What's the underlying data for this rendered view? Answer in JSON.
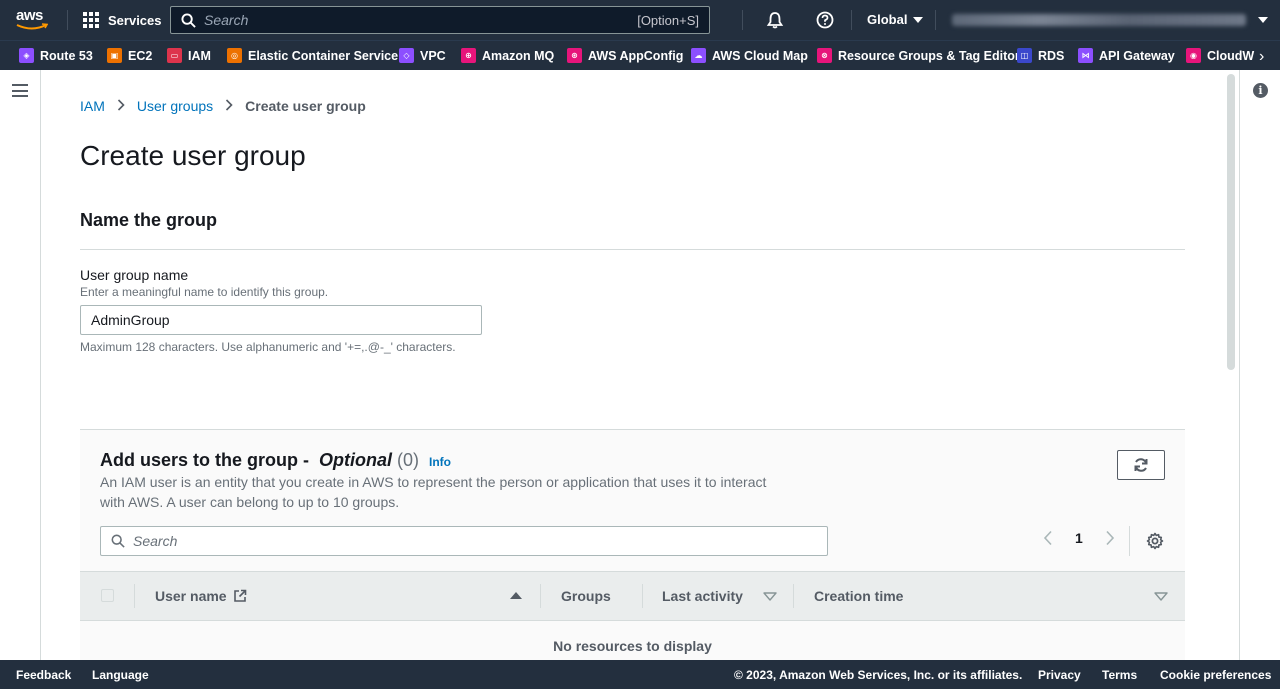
{
  "topnav": {
    "logo_text": "aws",
    "services_label": "Services",
    "search_placeholder": "Search",
    "search_shortcut": "[Option+S]",
    "region_label": "Global"
  },
  "favorites": [
    {
      "label": "Route 53",
      "color": "#8c4fff"
    },
    {
      "label": "EC2",
      "color": "#ed7100"
    },
    {
      "label": "IAM",
      "color": "#dd344c"
    },
    {
      "label": "Elastic Container Service",
      "color": "#ed7100"
    },
    {
      "label": "VPC",
      "color": "#8c4fff"
    },
    {
      "label": "Amazon MQ",
      "color": "#e7157b"
    },
    {
      "label": "AWS AppConfig",
      "color": "#e7157b"
    },
    {
      "label": "AWS Cloud Map",
      "color": "#8c4fff"
    },
    {
      "label": "Resource Groups & Tag Editor",
      "color": "#e7157b"
    },
    {
      "label": "RDS",
      "color": "#3b48cc"
    },
    {
      "label": "API Gateway",
      "color": "#8c4fff"
    },
    {
      "label": "CloudW",
      "color": "#e7157b"
    }
  ],
  "breadcrumb": {
    "items": [
      "IAM",
      "User groups",
      "Create user group"
    ]
  },
  "page_title": "Create user group",
  "name_section": {
    "title": "Name the group",
    "field_label": "User group name",
    "field_description": "Enter a meaningful name to identify this group.",
    "field_value": "AdminGroup",
    "field_constraint": "Maximum 128 characters. Use alphanumeric and '+=,.@-_' characters."
  },
  "users_section": {
    "title": "Add users to the group - ",
    "title_optional": "Optional",
    "count": "(0)",
    "info_label": "Info",
    "description": "An IAM user is an entity that you create in AWS to represent the person or application that uses it to interact with AWS. A user can belong to up to 10 groups.",
    "search_placeholder": "Search",
    "page_number": "1",
    "columns": [
      "User name",
      "Groups",
      "Last activity",
      "Creation time"
    ],
    "empty_message": "No resources to display"
  },
  "footer": {
    "feedback": "Feedback",
    "language": "Language",
    "copyright": "© 2023, Amazon Web Services, Inc. or its affiliates.",
    "privacy": "Privacy",
    "terms": "Terms",
    "cookie": "Cookie preferences"
  }
}
